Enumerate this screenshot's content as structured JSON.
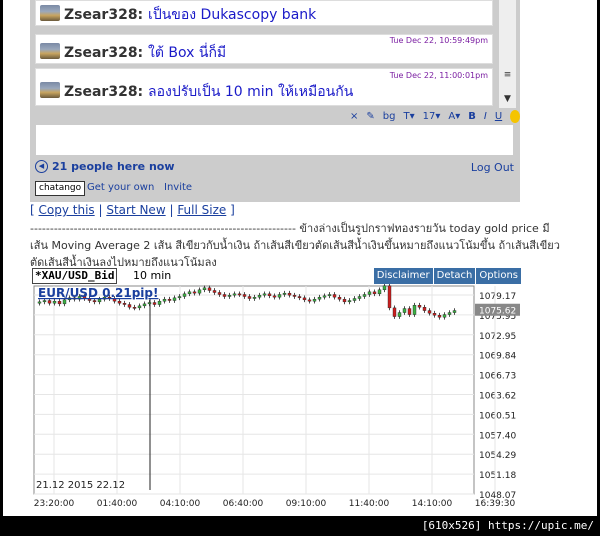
{
  "chat": {
    "messages": [
      {
        "user": "Zsear328:",
        "text": "เป็นของ Dukascopy bank",
        "time": "Tue Dec 22, 10:59:49pm"
      },
      {
        "user": "Zsear328:",
        "text": "ใต้ Box นี่ก็มี",
        "time": "Tue Dec 22, 10:59:49pm"
      },
      {
        "user": "Zsear328:",
        "text": "ลองปรับเป็น 10 min ให้เหมือนกัน",
        "time": "Tue Dec 22, 11:00:01pm"
      }
    ],
    "toolbar": [
      "×",
      "✎",
      "bg",
      "T▾",
      "17▾",
      "A▾",
      "B",
      "I",
      "U"
    ],
    "people_count": "21 people here now",
    "logout": "Log Out",
    "logo": "chatango",
    "get_own": "Get your own",
    "invite": "Invite"
  },
  "links": {
    "copy": "Copy this",
    "start_new": "Start New",
    "full_size": "Full Size"
  },
  "thai_paragraph": "------------------------------------------------------------------- ข้างล่างเป็นรูปกราฟทองรายวัน today gold price มีเส้น Moving Average 2 เส้น สีเขียวกับน้ำเงิน ถ้าเส้นสีเขียวตัดเส้นสีน้ำเงินขึ้นหมายถึงแนวโน้มขึ้น ถ้าเส้นสีเขียวตัดเส้นสีน้ำเงินลงไปหมายถึงแนวโน้มลง",
  "chart_widget": {
    "symbol": "*XAU/USD_Bid",
    "interval": "10 min",
    "buttons": [
      "Disclaimer",
      "Detach",
      "Options"
    ],
    "promo": "EUR/USD 0.21pip!",
    "timestamp": "21.12 2015 22.12",
    "current_price": "1075.62",
    "colors": {
      "up": "#3cb043",
      "down": "#cc1f1f",
      "button": "#3a6ea5"
    }
  },
  "chart_data": {
    "type": "candlestick",
    "y_ticks": [
      "1079.17",
      "1075.95",
      "1072.95",
      "1069.84",
      "1066.73",
      "1063.62",
      "1060.51",
      "1057.40",
      "1054.29",
      "1051.18",
      "1048.07"
    ],
    "x_ticks": [
      "23:20:00",
      "01:40:00",
      "04:10:00",
      "06:40:00",
      "09:10:00",
      "11:40:00",
      "14:10:00",
      "16:39:30"
    ],
    "ylim": [
      1048.07,
      1079.17
    ],
    "closes": [
      1076.8,
      1077.0,
      1076.6,
      1076.9,
      1076.5,
      1077.1,
      1077.4,
      1077.2,
      1077.6,
      1077.3,
      1077.0,
      1076.8,
      1077.2,
      1077.5,
      1077.3,
      1076.9,
      1076.6,
      1076.4,
      1076.0,
      1075.9,
      1076.2,
      1076.5,
      1076.7,
      1076.4,
      1076.9,
      1077.2,
      1077.0,
      1077.4,
      1077.6,
      1078.0,
      1078.3,
      1078.1,
      1078.6,
      1078.9,
      1078.5,
      1078.2,
      1077.9,
      1077.6,
      1077.8,
      1078.0,
      1077.9,
      1077.6,
      1077.3,
      1077.5,
      1077.8,
      1078.0,
      1077.7,
      1077.5,
      1077.9,
      1078.1,
      1077.8,
      1077.6,
      1077.4,
      1077.1,
      1076.9,
      1077.2,
      1077.5,
      1077.7,
      1077.9,
      1077.5,
      1077.2,
      1076.8,
      1077.0,
      1077.3,
      1077.6,
      1077.9,
      1078.3,
      1078.0,
      1078.6,
      1079.2,
      1075.9,
      1074.6,
      1075.2,
      1075.8,
      1074.9,
      1076.3,
      1076.0,
      1075.5,
      1075.1,
      1074.8,
      1074.5,
      1074.9,
      1075.2,
      1075.5
    ]
  }
}
